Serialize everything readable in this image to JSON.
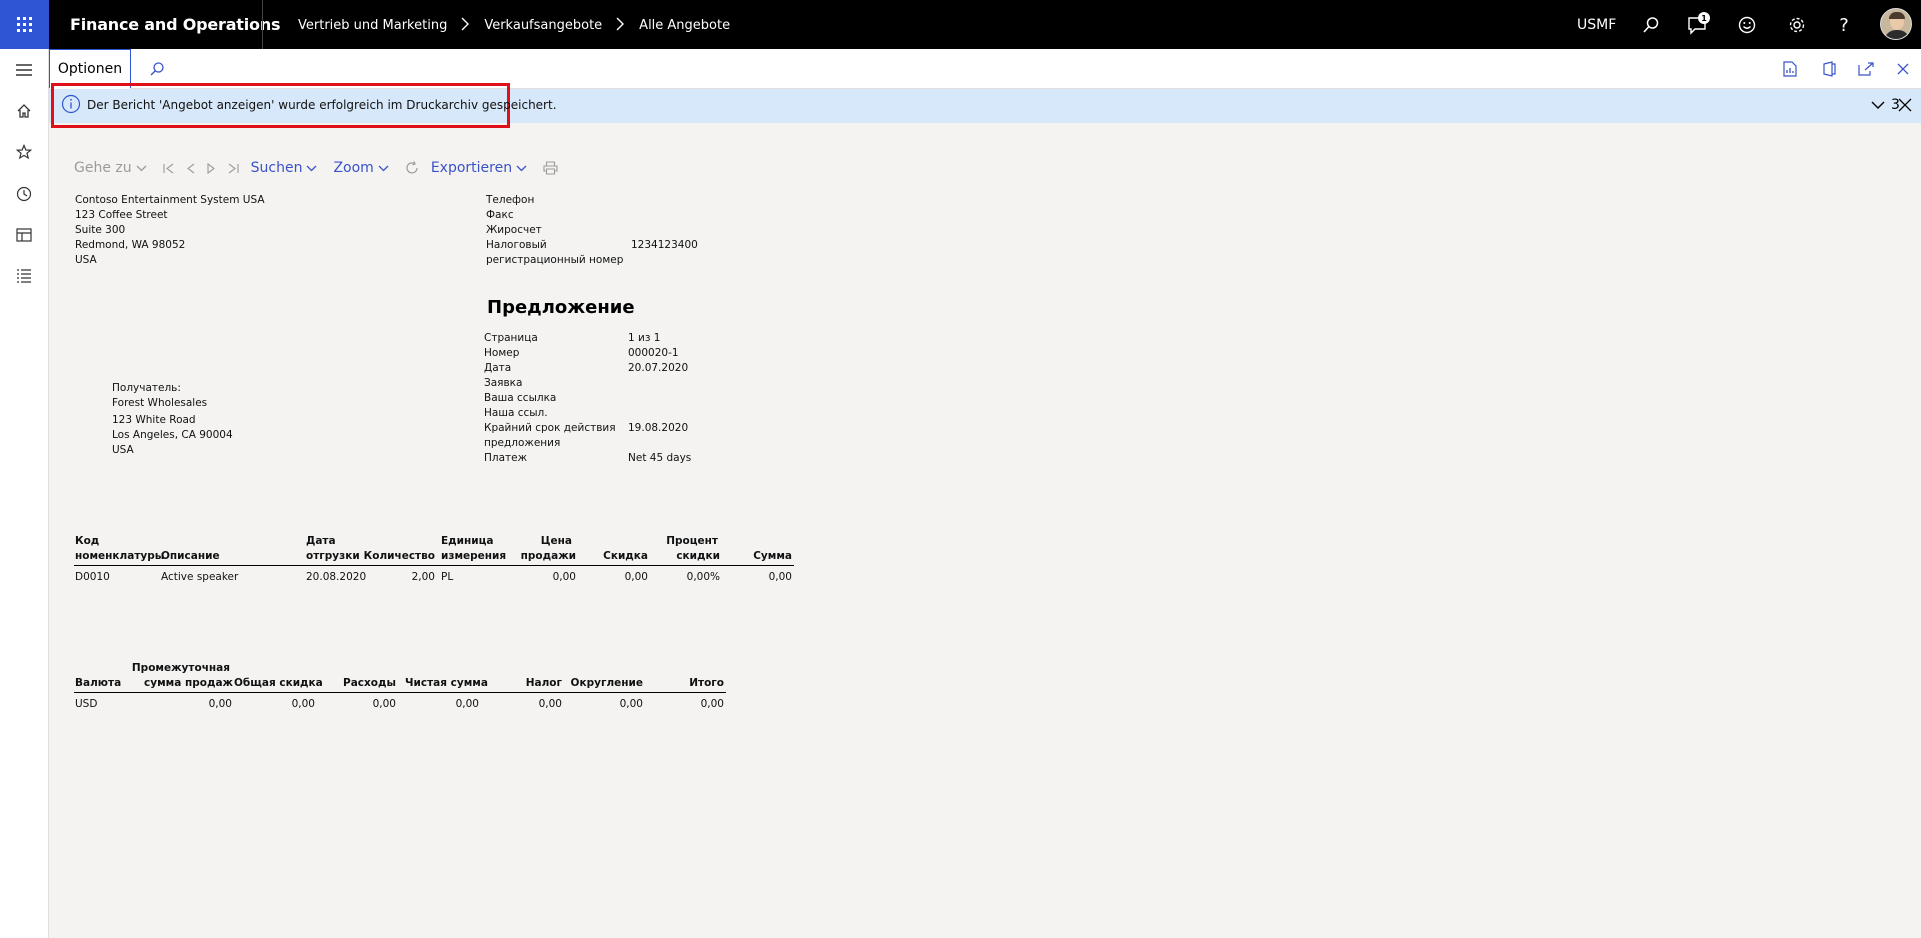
{
  "topbar": {
    "app_title": "Finance and Operations",
    "breadcrumbs": [
      "Vertrieb und Marketing",
      "Verkaufsangebote",
      "Alle Angebote"
    ],
    "company": "USMF",
    "notification_count": "1",
    "icons": [
      "waffle-icon",
      "search-icon",
      "notifications-icon",
      "feedback-smiley-icon",
      "settings-gear-icon",
      "help-icon",
      "user-avatar"
    ]
  },
  "leftnav": {
    "icons": [
      "hamburger-menu-icon",
      "home-icon",
      "favorites-star-icon",
      "recent-clock-icon",
      "workspaces-icon",
      "modules-list-icon"
    ]
  },
  "actionbar": {
    "tab_label": "Optionen",
    "icons": [
      "search-icon",
      "office-excel-icon",
      "office-icon",
      "open-new-window-icon",
      "close-icon"
    ]
  },
  "message": {
    "text": "Der Bericht 'Angebot anzeigen' wurde erfolgreich im Druckarchiv gespeichert.",
    "count": "3"
  },
  "viewer": {
    "goto": "Gehe zu",
    "search": "Suchen",
    "zoom": "Zoom",
    "export": "Exportieren"
  },
  "report": {
    "sender": [
      "Contoso Entertainment System USA",
      "123 Coffee Street",
      "Suite 300",
      "Redmond, WA 98052",
      "USA"
    ],
    "contact_labels": [
      "Телефон",
      "Факс",
      "Жиросчет",
      "Налоговый",
      "регистрационный номер"
    ],
    "tax_number": "1234123400",
    "title": "Предложение",
    "meta_labels": [
      "Страница",
      "Номер",
      "Дата",
      "Заявка",
      "Ваша ссылка",
      "Наша ссыл.",
      "Крайний срок действия",
      "предложения",
      "Платеж"
    ],
    "page_value": "1  из  1",
    "number_value": "000020-1",
    "date_value": "20.07.2020",
    "deadline_value": "19.08.2020",
    "payment_value": "Net 45 days",
    "recipient": [
      "Получатель:",
      "Forest Wholesales",
      "123 White Road",
      "Los Angeles, CA 90004",
      "USA"
    ],
    "lines_header": {
      "item_code_1": "Код",
      "item_code_2": "номенклатуры",
      "description": "Описание",
      "ship_date_1": "Дата",
      "ship_date_2": "отгрузки",
      "quantity": "Количество",
      "unit_1": "Единица",
      "unit_2": "измерения",
      "price_1": "Цена",
      "price_2": "продажи",
      "discount": "Скидка",
      "disc_pct_1": "Процент",
      "disc_pct_2": "скидки",
      "amount": "Сумма"
    },
    "lines": [
      {
        "item": "D0010",
        "description": "Active speaker",
        "ship_date": "20.08.2020",
        "quantity": "2,00",
        "unit": "PL",
        "price": "0,00",
        "discount": "0,00",
        "disc_pct": "0,00%",
        "amount": "0,00"
      }
    ],
    "totals_header": {
      "currency": "Валюта",
      "subtotal_1": "Промежуточная",
      "subtotal_2": "сумма продаж",
      "total_discount": "Общая скидка",
      "charges": "Расходы",
      "net": "Чистая сумма",
      "tax": "Налог",
      "rounding": "Округление",
      "total": "Итого"
    },
    "totals": {
      "currency": "USD",
      "subtotal": "0,00",
      "total_discount": "0,00",
      "charges": "0,00",
      "net": "0,00",
      "tax": "0,00",
      "rounding": "0,00",
      "total": "0,00"
    }
  }
}
